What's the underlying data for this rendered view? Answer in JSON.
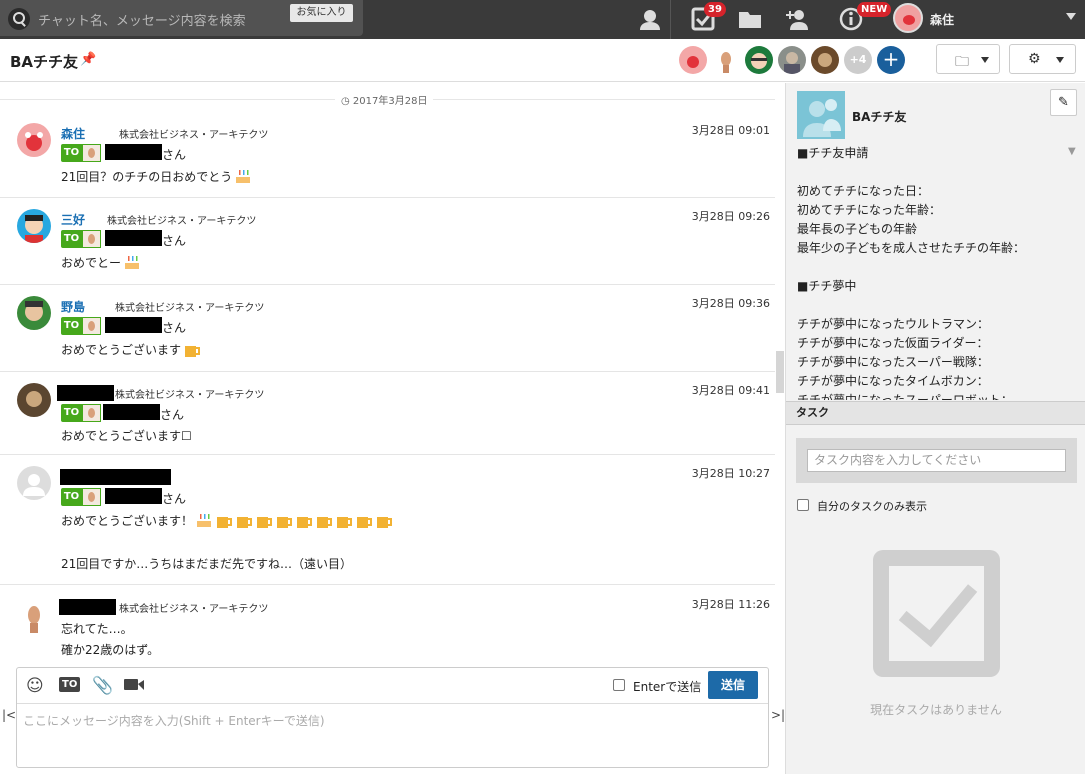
{
  "search": {
    "placeholder": "チャット名、メッセージ内容を検索",
    "favorites_label": "お気に入り"
  },
  "topbar": {
    "task_badge": "39",
    "new_badge": "NEW",
    "user_name": "森住"
  },
  "room": {
    "title": "BAチチ友",
    "more_members": "+4"
  },
  "date_separator": "2017年3月28日",
  "messages": [
    {
      "sender": "森住",
      "org": "株式会社ビジネス・アーキテクツ",
      "time": "3月28日 09:01",
      "to": "TO",
      "san": "さん",
      "body": "21回目？のチチの日おめでとう"
    },
    {
      "sender": "三好",
      "org": "株式会社ビジネス・アーキテクツ",
      "time": "3月28日 09:26",
      "to": "TO",
      "san": "さん",
      "body": "おめでとー"
    },
    {
      "sender": "野島",
      "org": "株式会社ビジネス・アーキテクツ",
      "time": "3月28日 09:36",
      "to": "TO",
      "san": "さん",
      "body": "おめでとうございます"
    },
    {
      "sender": "",
      "org": "株式会社ビジネス・アーキテクツ",
      "time": "3月28日 09:41",
      "to": "TO",
      "san": "さん",
      "body": "おめでとうございます☐"
    },
    {
      "sender": "",
      "org": "",
      "time": "3月28日 10:27",
      "to": "TO",
      "san": "さん",
      "body": "おめでとうございます！",
      "body2": "21回目ですか…うちはまだまだ先ですね…（遠い目）"
    },
    {
      "sender": "",
      "org": "株式会社ビジネス・アーキテクツ",
      "time": "3月28日 11:26",
      "body": "忘れてた…。",
      "body2": "確か22歳のはず。"
    }
  ],
  "composer": {
    "to_label": "TO",
    "enter_label": "Enterで送信",
    "send_label": "送信",
    "placeholder": "ここにメッセージ内容を入力(Shift + Enterキーで送信)"
  },
  "side": {
    "title": "BAチチ友",
    "description": [
      "■チチ友申請",
      "",
      "初めてチチになった日：",
      "初めてチチになった年齢：",
      "最年長の子どもの年齢",
      "最年少の子どもを成人させたチチの年齢：",
      "",
      "■チチ夢中",
      "",
      "チチが夢中になったウルトラマン：",
      "チチが夢中になった仮面ライダー：",
      "チチが夢中になったスーパー戦隊：",
      "チチが夢中になったタイムボカン：",
      "チチが夢中になったスーパーロボット："
    ],
    "task_header": "タスク",
    "task_placeholder": "タスク内容を入力してください",
    "my_tasks_label": "自分のタスクのみ表示",
    "empty_text": "現在タスクはありません"
  },
  "colors": {
    "topbar": "#3a3a3a",
    "send": "#1d6aa8",
    "to_tag": "#46a81b",
    "sender": "#1a6fb3"
  }
}
